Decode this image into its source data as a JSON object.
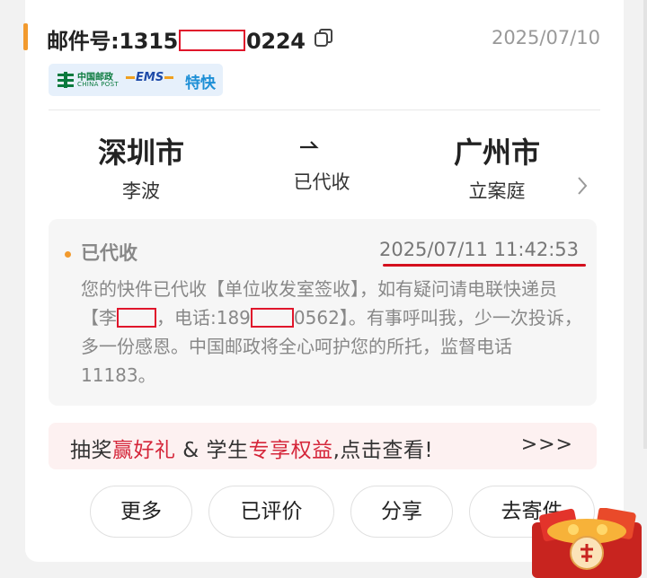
{
  "order": {
    "tracking_label": "邮件号:",
    "tracking_prefix": "1315",
    "tracking_suffix": "0224",
    "date": "2025/07/10"
  },
  "brand": {
    "post_cn": "中国邮政",
    "post_en": "CHINA POST",
    "ems": "EMS",
    "express": "特快"
  },
  "route": {
    "from_city": "深圳市",
    "from_name": "李波",
    "status": "已代收",
    "to_city": "广州市",
    "to_name": "立案庭"
  },
  "tracking_event": {
    "title": "已代收",
    "time": "2025/07/11 11:42:53",
    "detail_1": "您的快件已代收【单位收发室签收】，如有疑问请电联快递员【李",
    "detail_2": "，电话:189",
    "detail_3": "0562】。有事呼叫我，少一次投诉，多一份感恩。中国邮政将全心呵护您的所托，监督电话11183。"
  },
  "promo": {
    "part_1": "抽奖",
    "part_2": "赢好礼",
    "part_3": " & 学生",
    "part_4": "专享权益",
    "part_5": ",点击查看!",
    "arrows": ">>>"
  },
  "actions": {
    "more": "更多",
    "review": "已评价",
    "share": "分享",
    "ship": "去寄件"
  },
  "colors": {
    "accent": "#f29a2e",
    "redaction": "#e0162b",
    "promo_red": "#d5263a"
  }
}
